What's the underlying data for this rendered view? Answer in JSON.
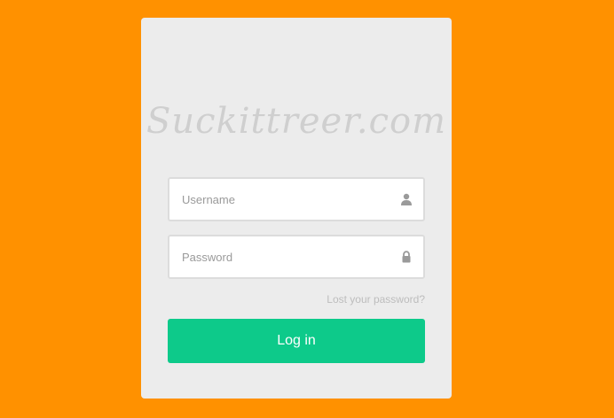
{
  "logo": {
    "text": "Suckittreer.com"
  },
  "form": {
    "username": {
      "placeholder": "Username",
      "value": "",
      "icon": "user-icon"
    },
    "password": {
      "placeholder": "Password",
      "value": "",
      "icon": "lock-icon"
    },
    "lost_password_label": "Lost your password?",
    "login_label": "Log in"
  },
  "colors": {
    "background": "#ff9100",
    "card": "#ececec",
    "button": "#0dca8a"
  }
}
